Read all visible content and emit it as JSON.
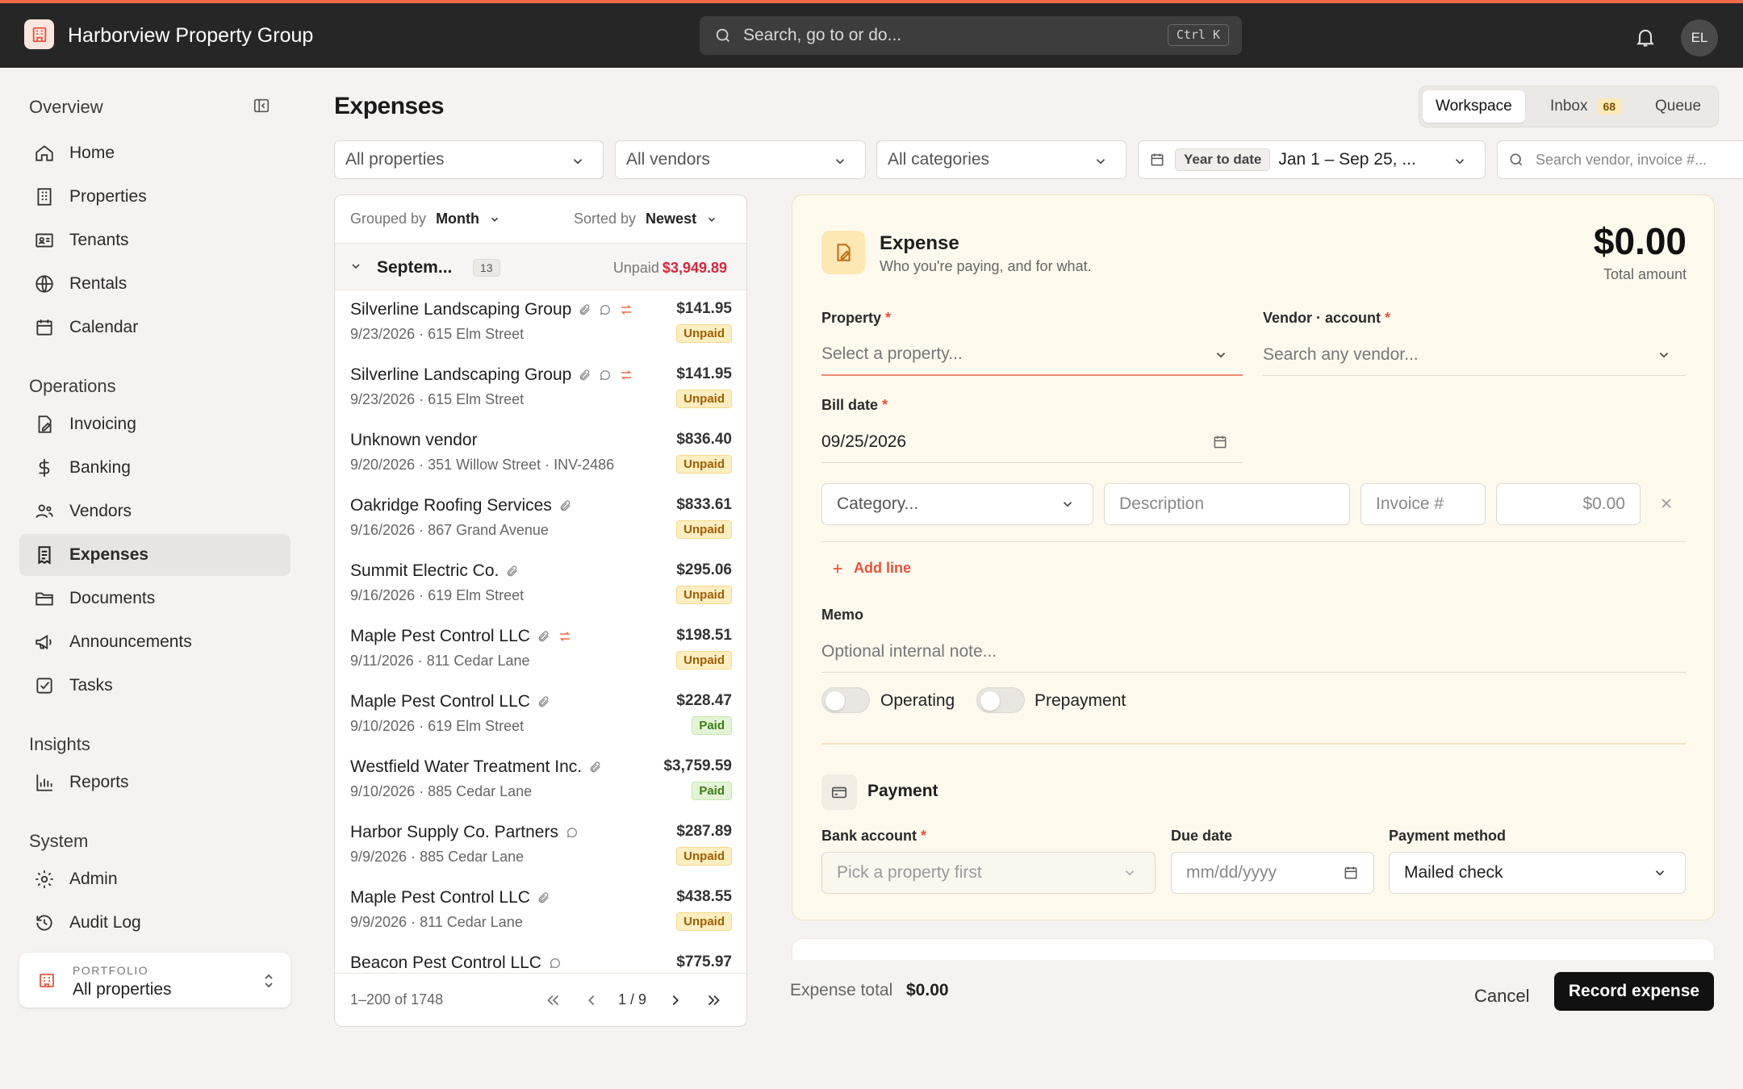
{
  "app": {
    "title": "Harborview Property Group",
    "user_initials": "EL"
  },
  "search": {
    "placeholder": "Search, go to or do...",
    "shortcut": "Ctrl K"
  },
  "sidebar": {
    "sections": [
      "Overview",
      "Operations",
      "Insights",
      "System"
    ],
    "overview": [
      {
        "label": "Home",
        "icon": "home-icon"
      },
      {
        "label": "Properties",
        "icon": "building-icon"
      },
      {
        "label": "Tenants",
        "icon": "id-card-icon"
      },
      {
        "label": "Rentals",
        "icon": "globe-icon"
      },
      {
        "label": "Calendar",
        "icon": "calendar-icon"
      }
    ],
    "operations": [
      {
        "label": "Invoicing",
        "icon": "invoice-icon"
      },
      {
        "label": "Banking",
        "icon": "dollar-icon"
      },
      {
        "label": "Vendors",
        "icon": "users-icon"
      },
      {
        "label": "Expenses",
        "icon": "receipt-icon",
        "active": true
      },
      {
        "label": "Documents",
        "icon": "folder-icon"
      },
      {
        "label": "Announcements",
        "icon": "megaphone-icon"
      },
      {
        "label": "Tasks",
        "icon": "checkbox-icon"
      }
    ],
    "insights": [
      {
        "label": "Reports",
        "icon": "bar-chart-icon"
      }
    ],
    "system": [
      {
        "label": "Admin",
        "icon": "gear-icon"
      },
      {
        "label": "Audit Log",
        "icon": "history-icon"
      }
    ],
    "portfolio": {
      "label": "PORTFOLIO",
      "value": "All properties"
    }
  },
  "page": {
    "title": "Expenses"
  },
  "view_tabs": {
    "workspace": "Workspace",
    "inbox": "Inbox",
    "inbox_count": "68",
    "queue": "Queue"
  },
  "filters": {
    "properties": "All properties",
    "vendors": "All vendors",
    "categories": "All categories",
    "period_badge": "Year to date",
    "date_range": "Jan 1 – Sep 25, ...",
    "search_placeholder": "Search vendor, invoice #..."
  },
  "list": {
    "grouped_label": "Grouped by",
    "grouped_value": "Month",
    "sorted_label": "Sorted by",
    "sorted_value": "Newest",
    "group": {
      "name": "Septem...",
      "count": "13",
      "unpaid_label": "Unpaid",
      "unpaid_amount": "$3,949.89"
    },
    "rows": [
      {
        "vendor": "Silverline Landscaping Group",
        "meta": "9/23/2026 · 615 Elm Street",
        "amount": "$141.95",
        "status": "Unpaid",
        "clip": true,
        "comment": true,
        "recur": true
      },
      {
        "vendor": "Silverline Landscaping Group",
        "meta": "9/23/2026 · 615 Elm Street",
        "amount": "$141.95",
        "status": "Unpaid",
        "clip": true,
        "comment": true,
        "recur": true
      },
      {
        "vendor": "Unknown vendor",
        "meta": "9/20/2026 · 351 Willow Street · INV-2486",
        "amount": "$836.40",
        "status": "Unpaid"
      },
      {
        "vendor": "Oakridge Roofing Services",
        "meta": "9/16/2026 · 867 Grand Avenue",
        "amount": "$833.61",
        "status": "Unpaid",
        "clip": true
      },
      {
        "vendor": "Summit Electric Co.",
        "meta": "9/16/2026 · 619 Elm Street",
        "amount": "$295.06",
        "status": "Unpaid",
        "clip": true
      },
      {
        "vendor": "Maple Pest Control LLC",
        "meta": "9/11/2026 · 811 Cedar Lane",
        "amount": "$198.51",
        "status": "Unpaid",
        "clip": true,
        "recur": true
      },
      {
        "vendor": "Maple Pest Control LLC",
        "meta": "9/10/2026 · 619 Elm Street",
        "amount": "$228.47",
        "status": "Paid",
        "clip": true
      },
      {
        "vendor": "Westfield Water Treatment Inc.",
        "meta": "9/10/2026 · 885 Cedar Lane",
        "amount": "$3,759.59",
        "status": "Paid",
        "clip": true
      },
      {
        "vendor": "Harbor Supply Co. Partners",
        "meta": "9/9/2026 · 885 Cedar Lane",
        "amount": "$287.89",
        "status": "Unpaid",
        "comment": true
      },
      {
        "vendor": "Maple Pest Control LLC",
        "meta": "9/9/2026 · 811 Cedar Lane",
        "amount": "$438.55",
        "status": "Unpaid",
        "clip": true
      },
      {
        "vendor": "Beacon Pest Control LLC",
        "meta": "",
        "amount": "$775.97",
        "status": "",
        "comment": true
      }
    ],
    "pagination": {
      "range": "1–200 of 1748",
      "page": "1 / 9"
    }
  },
  "expense_form": {
    "title": "Expense",
    "subtitle": "Who you're paying, and for what.",
    "total": "$0.00",
    "total_label": "Total amount",
    "property_label": "Property",
    "property_placeholder": "Select a property...",
    "vendor_label": "Vendor · account",
    "vendor_placeholder": "Search any vendor...",
    "bill_date_label": "Bill date",
    "bill_date": "09/25/2026",
    "line": {
      "category": "Category...",
      "description": "Description",
      "invoice": "Invoice #",
      "amount": "$0.00"
    },
    "add_line": "Add line",
    "memo_label": "Memo",
    "memo_placeholder": "Optional internal note...",
    "toggles": {
      "operating": "Operating",
      "prepayment": "Prepayment"
    },
    "payment_title": "Payment",
    "bank_label": "Bank account",
    "bank_placeholder": "Pick a property first",
    "due_label": "Due date",
    "due_placeholder": "mm/dd/yyyy",
    "method_label": "Payment method",
    "method_value": "Mailed check"
  },
  "footer": {
    "total_label": "Expense total",
    "total_value": "$0.00",
    "cancel": "Cancel",
    "record": "Record expense"
  },
  "colors": {
    "accent": "#ef6a4a",
    "unpaid": "#d7263d",
    "topbar": "#262626"
  }
}
